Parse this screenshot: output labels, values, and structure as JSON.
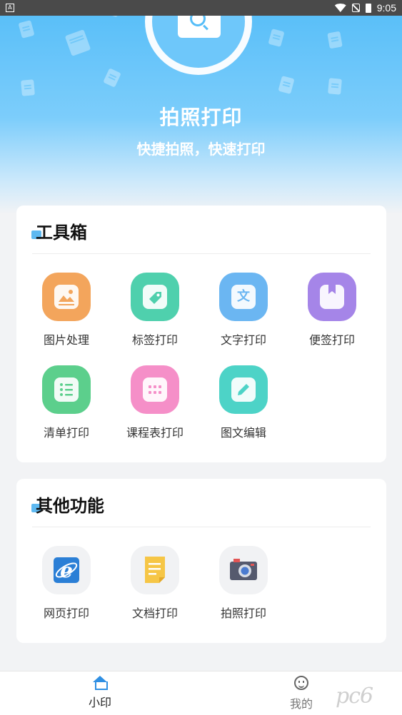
{
  "status_bar": {
    "time": "9:05",
    "notification_glyph": "A"
  },
  "hero": {
    "title": "拍照打印",
    "subtitle": "快捷拍照，快速打印"
  },
  "toolbox": {
    "title": "工具箱",
    "items": [
      {
        "label": "图片处理",
        "icon": "image-icon",
        "color": "#f3a55c"
      },
      {
        "label": "标签打印",
        "icon": "tag-icon",
        "color": "#4fd0ad"
      },
      {
        "label": "文字打印",
        "icon": "text-icon",
        "glyph": "文",
        "color": "#6bb6f2"
      },
      {
        "label": "便签打印",
        "icon": "bookmark-note-icon",
        "color": "#a585e8"
      },
      {
        "label": "清单打印",
        "icon": "list-icon",
        "color": "#5ccf8c"
      },
      {
        "label": "课程表打印",
        "icon": "calendar-icon",
        "color": "#f58fc8"
      },
      {
        "label": "图文编辑",
        "icon": "edit-pencil-icon",
        "color": "#4dd3c7"
      }
    ]
  },
  "other": {
    "title": "其他功能",
    "items": [
      {
        "label": "网页打印",
        "icon": "browser-ie-icon",
        "color": "#2b7fd6"
      },
      {
        "label": "文档打印",
        "icon": "document-icon",
        "color": "#f6c646"
      },
      {
        "label": "拍照打印",
        "icon": "camera-icon",
        "color": "#555a6e"
      }
    ]
  },
  "bottom_nav": {
    "items": [
      {
        "label": "小印",
        "icon": "home-icon",
        "active": true
      },
      {
        "label": "我的",
        "icon": "profile-face-icon",
        "active": false
      }
    ]
  },
  "watermark": "pc6"
}
